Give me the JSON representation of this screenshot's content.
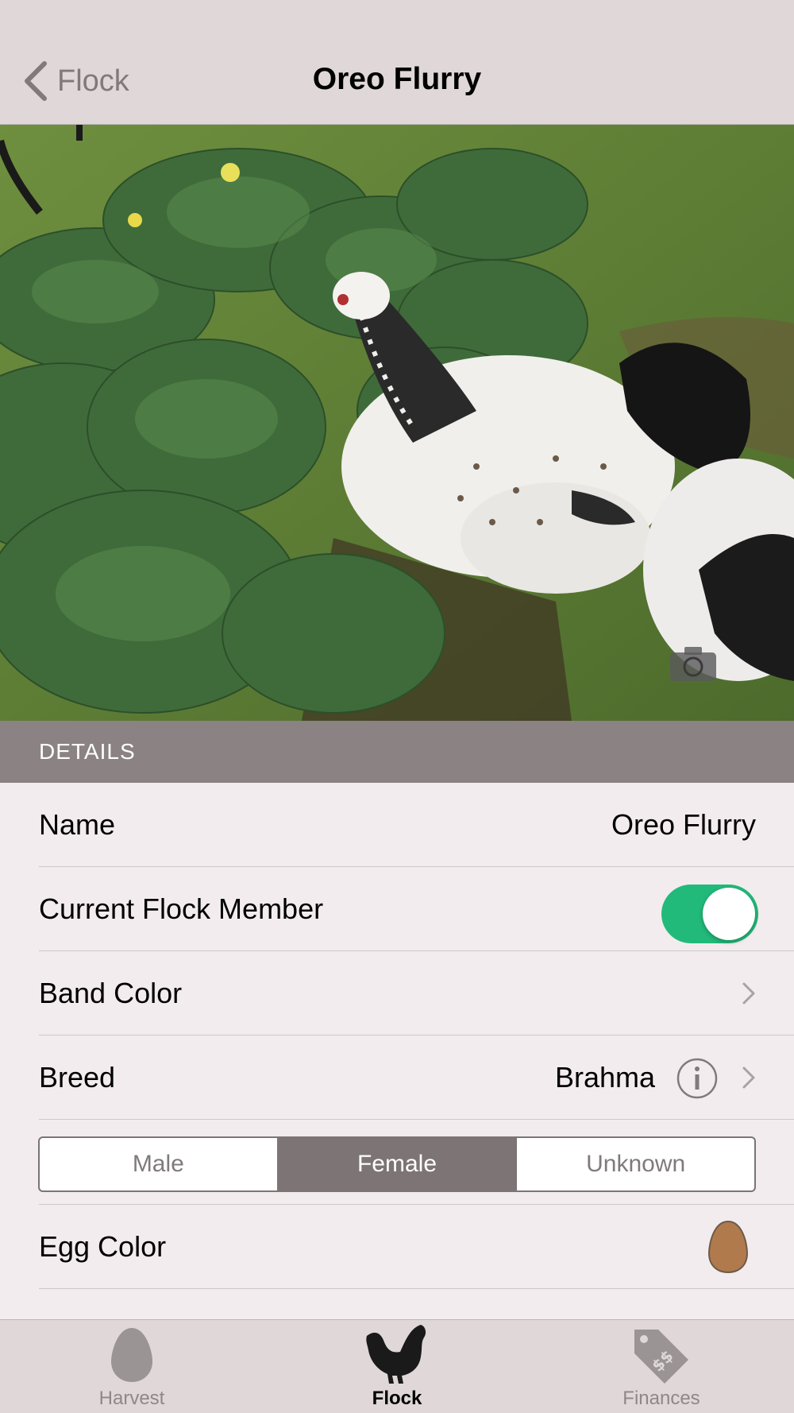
{
  "nav": {
    "back_label": "Flock",
    "title": "Oreo Flurry"
  },
  "photo": {
    "subject": "chicken-photo",
    "camera_icon": "camera-icon"
  },
  "details": {
    "header": "DETAILS",
    "name_label": "Name",
    "name_value": "Oreo Flurry",
    "member_label": "Current Flock Member",
    "member_on": true,
    "band_label": "Band Color",
    "breed_label": "Breed",
    "breed_value": "Brahma",
    "sex_options": [
      "Male",
      "Female",
      "Unknown"
    ],
    "sex_selected": "Female",
    "egg_label": "Egg Color",
    "egg_color": "#b07a4c"
  },
  "tabs": [
    {
      "label": "Harvest",
      "icon": "egg-icon"
    },
    {
      "label": "Flock",
      "icon": "chicken-icon"
    },
    {
      "label": "Finances",
      "icon": "price-tag-icon"
    }
  ],
  "colors": {
    "accent_green": "#22ba7b",
    "header_gray": "#8b8283",
    "bar_bg": "#dfd7d8"
  }
}
